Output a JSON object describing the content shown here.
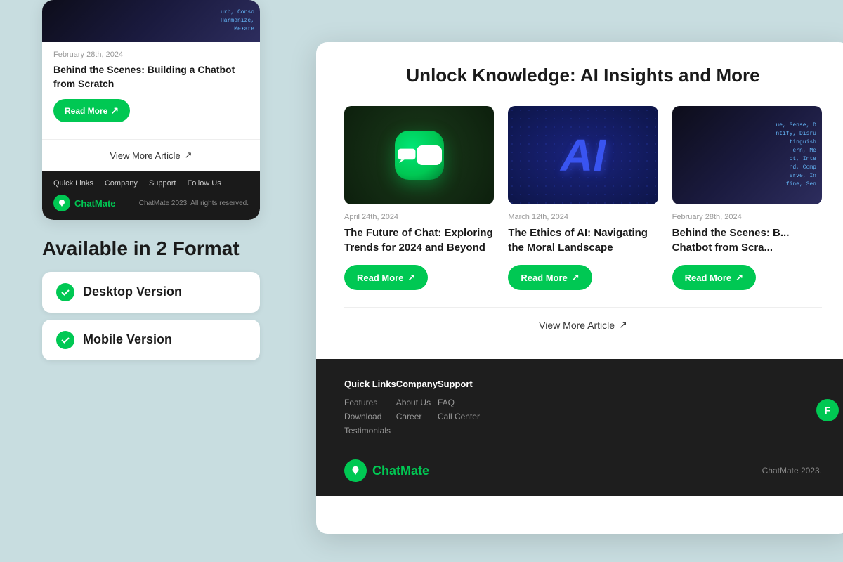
{
  "background_color": "#c8dde0",
  "left_panel": {
    "article": {
      "date": "February 28th, 2024",
      "title": "Behind the Scenes: Building a Chatbot from Scratch",
      "read_more_label": "Read More",
      "view_more_label": "View More Article"
    },
    "footer": {
      "nav_items": [
        "Quick Links",
        "Company",
        "Support",
        "Follow Us"
      ],
      "brand_name": "ChatMate",
      "copyright": "ChatMate 2023. All rights reserved."
    }
  },
  "formats_section": {
    "title": "Available in 2 Format",
    "options": [
      {
        "label": "Desktop Version"
      },
      {
        "label": "Mobile Version"
      }
    ]
  },
  "right_panel": {
    "section_title": "Unlock Knowledge: AI Insights and More",
    "articles": [
      {
        "date": "April 24th, 2024",
        "title": "The Future of Chat: Exploring Trends for 2024 and Beyond",
        "read_more_label": "Read More",
        "image_type": "chat"
      },
      {
        "date": "March 12th, 2024",
        "title": "The Ethics of AI: Navigating the Moral Landscape",
        "read_more_label": "Read More",
        "image_type": "ai"
      },
      {
        "date": "February 28th, 2024",
        "title": "Behind the Scenes: B... Chatbot from Scra...",
        "read_more_label": "Read More",
        "image_type": "code"
      }
    ],
    "view_more_label": "View More Article",
    "footer": {
      "columns": [
        {
          "heading": "Quick Links",
          "items": [
            "Features",
            "Download",
            "Testimonials"
          ]
        },
        {
          "heading": "Company",
          "items": [
            "About Us",
            "Career"
          ]
        },
        {
          "heading": "Support",
          "items": [
            "FAQ",
            "Call Center"
          ]
        }
      ],
      "brand_name": "ChatMate",
      "copyright": "ChatMate 2023.",
      "follow_badge": "F"
    }
  }
}
